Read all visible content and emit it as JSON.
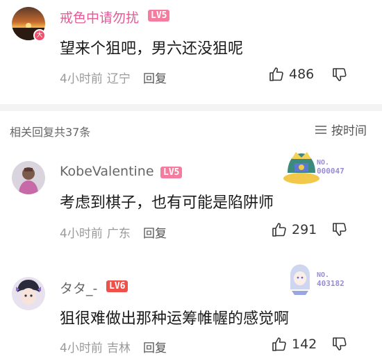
{
  "top_comment": {
    "username": "戒色中请勿扰",
    "level": "LV5",
    "level_color": "#f57c9f",
    "text": "望来个狙吧，男六还没狙呢",
    "time": "4小时前",
    "location": "辽宁",
    "reply": "回复",
    "likes": "486",
    "username_color": "#e35a96"
  },
  "replies_header": {
    "count_text": "相关回复共37条",
    "sort_label": "按时间"
  },
  "replies": [
    {
      "username": "KobeValentine",
      "level": "LV5",
      "level_color": "#f57c9f",
      "badge_label": "NO.",
      "badge_number": "000047",
      "text": "考虑到棋子，也有可能是陷阱师",
      "time": "4小时前",
      "location": "广东",
      "reply": "回复",
      "likes": "291",
      "username_color": "#666666"
    },
    {
      "username": "タタ_-",
      "level": "LV6",
      "level_color": "#f0504a",
      "badge_label": "NO.",
      "badge_number": "403182",
      "text": "狙很难做出那种运筹帷幄的感觉啊",
      "time": "4小时前",
      "location": "吉林",
      "reply": "回复",
      "likes": "142",
      "username_color": "#666666"
    }
  ]
}
